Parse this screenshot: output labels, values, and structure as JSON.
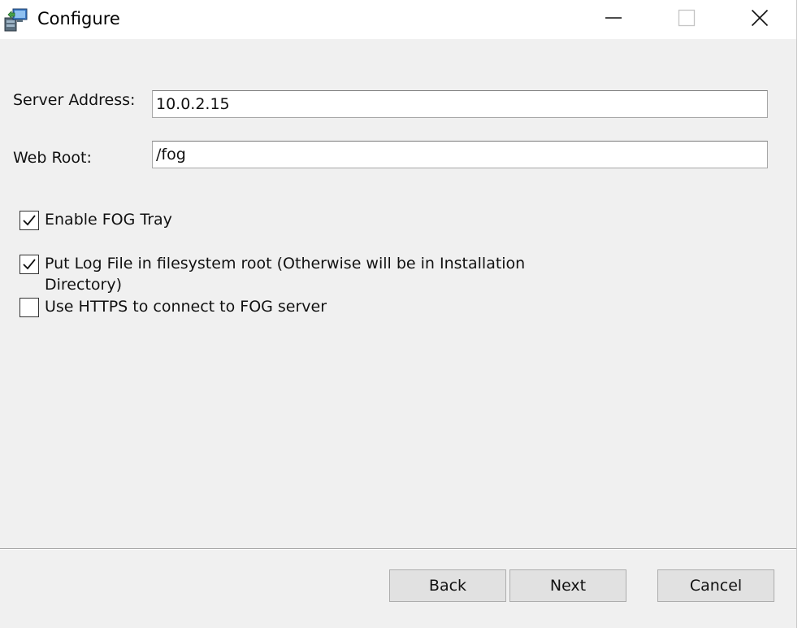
{
  "window": {
    "title": "Configure",
    "controls": {
      "minimize": "minimize-icon",
      "maximize": "maximize-icon",
      "close": "close-icon"
    }
  },
  "form": {
    "server_address": {
      "label": "Server Address:",
      "value": "10.0.2.15"
    },
    "web_root": {
      "label": "Web Root:",
      "value": "/fog"
    }
  },
  "options": [
    {
      "label": "Enable FOG Tray",
      "checked": true
    },
    {
      "label": "Put Log File in filesystem root (Otherwise will be in Installation Directory)",
      "checked": true
    },
    {
      "label": "Use HTTPS to connect to FOG server",
      "checked": false
    }
  ],
  "buttons": {
    "back": "Back",
    "next": "Next",
    "cancel": "Cancel"
  },
  "colors": {
    "window_bg": "#f0f0f0",
    "titlebar_bg": "#ffffff",
    "button_bg": "#e1e1e1"
  }
}
